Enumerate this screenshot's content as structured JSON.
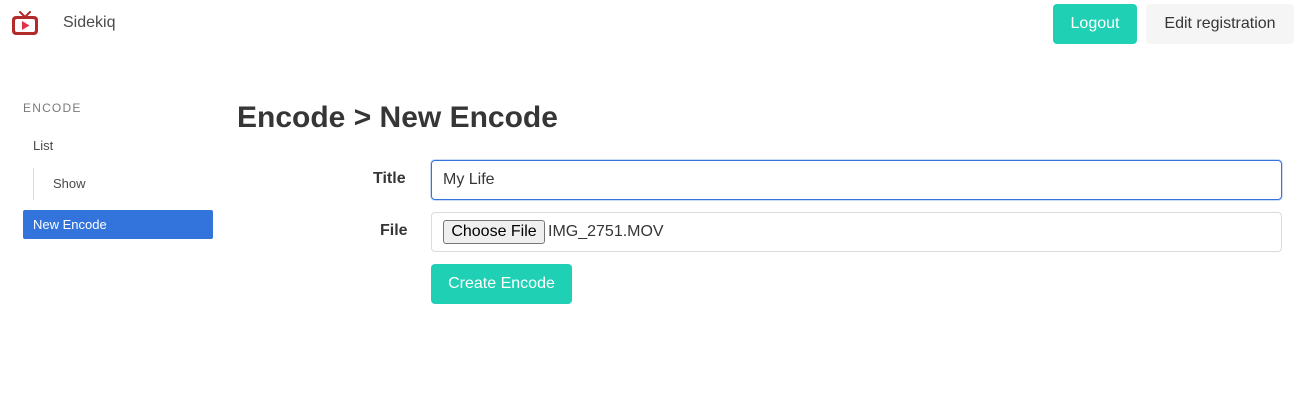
{
  "navbar": {
    "brand": "Sidekiq",
    "logo_icon": "tv-play-icon",
    "logout_label": "Logout",
    "edit_registration_label": "Edit registration"
  },
  "sidebar": {
    "section_label": "ENCODE",
    "items": [
      {
        "label": "List",
        "active": false
      },
      {
        "label": "Show",
        "active": false
      },
      {
        "label": "New Encode",
        "active": true
      }
    ]
  },
  "main": {
    "title": "Encode > New Encode",
    "form": {
      "title_label": "Title",
      "title_value": "My Life",
      "file_label": "File",
      "choose_file_label": "Choose File",
      "file_name": "IMG_2751.MOV",
      "submit_label": "Create Encode"
    }
  },
  "colors": {
    "primary": "#1fd0b4",
    "link_active": "#3273dc",
    "logo": "#b22a2a"
  }
}
